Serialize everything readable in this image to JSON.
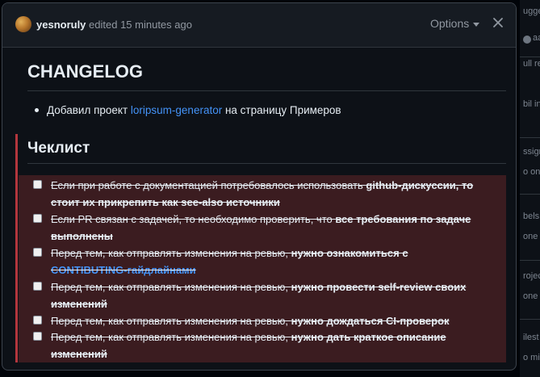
{
  "header": {
    "username": "yesnoruly",
    "action": " edited 15 minutes ago",
    "options_label": "Options"
  },
  "body": {
    "changelog_heading": "CHANGELOG",
    "changelog_item": {
      "before": "Добавил проект ",
      "link": "loripsum-generator",
      "after": " на страницу Примеров"
    },
    "checklist_heading": "Чеклист",
    "tasks": [
      {
        "pre": "Если при работе с документацией потребовалось использовать ",
        "strong": "github-дискуссии, то стоит их прикрепить как see-also источники",
        "link": "",
        "post": ""
      },
      {
        "pre": "Если PR связан с задачей, то необходимо проверить, что ",
        "strong": "все требования по задаче выполнены",
        "link": "",
        "post": ""
      },
      {
        "pre": "Перед тем, как отправлять изменения на ревью, ",
        "strong": "нужно ознакомиться с ",
        "link": "CONTIBUTING-гайдлайнами",
        "post": ""
      },
      {
        "pre": "Перед тем, как отправлять изменения на ревью, ",
        "strong": "нужно провести self-review своих изменений",
        "link": "",
        "post": ""
      },
      {
        "pre": "Перед тем, как отправлять изменения на ревью, ",
        "strong": "нужно дождаться CI-проверок",
        "link": "",
        "post": ""
      },
      {
        "pre": "Перед тем, как отправлять изменения на ревью, ",
        "strong": "нужно дать краткое описание изменений",
        "link": "",
        "post": ""
      }
    ]
  },
  "background": {
    "fragments": [
      "ugge",
      "aa",
      "ull re",
      "bil in",
      "ssign",
      "o on",
      "bels",
      "one y",
      "rojec",
      "one y",
      "ilest",
      "o mil"
    ]
  },
  "colors": {
    "accent_link": "#4493f8",
    "warning_bar": "#b3363d",
    "checklist_bg": "#3b1c20"
  }
}
